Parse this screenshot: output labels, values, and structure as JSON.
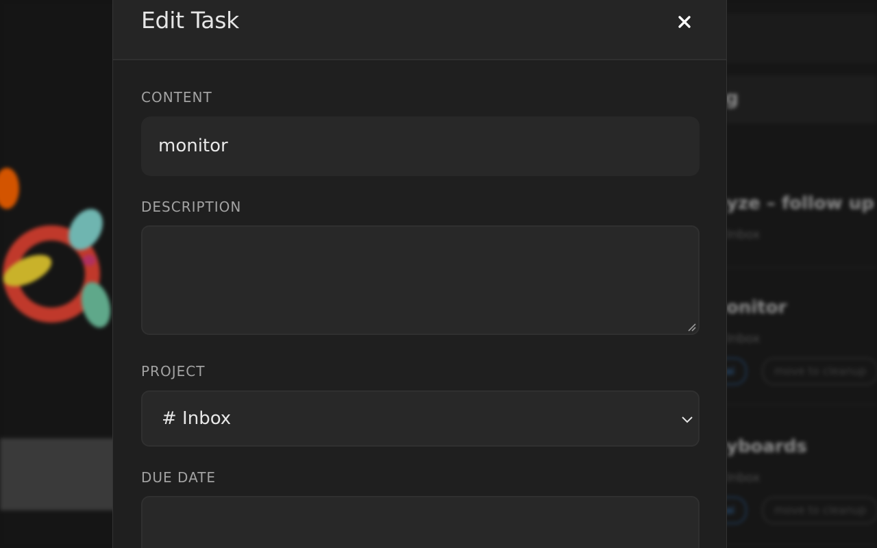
{
  "modal": {
    "title": "Edit Task",
    "close_icon": "close-icon"
  },
  "fields": {
    "content": {
      "label": "CONTENT",
      "value": "monitor"
    },
    "description": {
      "label": "DESCRIPTION",
      "value": ""
    },
    "project": {
      "label": "PROJECT",
      "selected": "# Inbox"
    },
    "due_date": {
      "label": "DUE DATE",
      "value": ""
    }
  },
  "background": {
    "header_fragment": "g",
    "tasks": [
      {
        "title": "yze – follow up",
        "sub": "Inbox"
      },
      {
        "title": "onitor",
        "sub": "Inbox",
        "chips": [
          "ai",
          "move to cleanup"
        ]
      },
      {
        "title": "yboards",
        "sub": "Inbox",
        "chips": [
          "ai",
          "move to cleanup"
        ]
      }
    ]
  },
  "colors": {
    "modal_bg": "#1f1f1f",
    "header_bg": "#252525",
    "input_bg": "#282828",
    "text": "#e6e6e6",
    "label": "#a3a3a3"
  }
}
